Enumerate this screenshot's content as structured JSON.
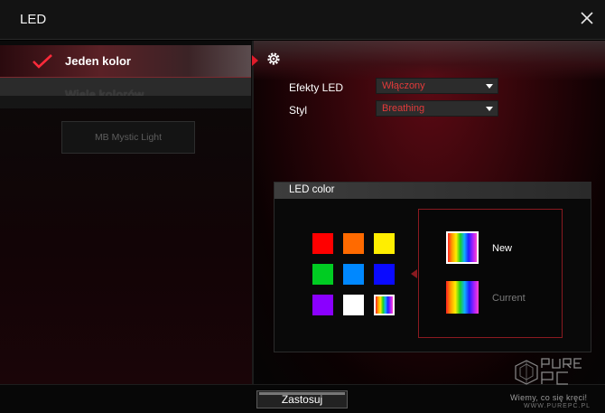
{
  "window": {
    "title": "LED"
  },
  "sidebar": {
    "items": [
      {
        "label": "Jeden kolor",
        "active": true
      },
      {
        "label": "Wiele kolorów",
        "active": false
      }
    ],
    "mb_button": "MB Mystic Light"
  },
  "settings": {
    "effects_label": "Efekty LED",
    "effects_value": "Włączony",
    "style_label": "Styl",
    "style_value": "Breathing"
  },
  "led_color": {
    "title": "LED color",
    "swatches": [
      {
        "name": "red",
        "color": "#ff0000"
      },
      {
        "name": "orange",
        "color": "#ff6a00"
      },
      {
        "name": "yellow",
        "color": "#ffee00"
      },
      {
        "name": "green",
        "color": "#00cc22"
      },
      {
        "name": "sky-blue",
        "color": "#0088ff"
      },
      {
        "name": "blue",
        "color": "#0a0aff"
      },
      {
        "name": "purple",
        "color": "#8a00ff"
      },
      {
        "name": "white",
        "color": "#ffffff"
      },
      {
        "name": "rainbow",
        "color": "rainbow",
        "selected": true
      }
    ],
    "new_label": "New",
    "current_label": "Current"
  },
  "footer": {
    "apply_label": "Zastosuj"
  },
  "watermark": {
    "text": "Wiemy, co się kręci!",
    "url": "WWW.PUREPC.PL",
    "logo": "PURE PC"
  },
  "colors": {
    "accent": "#e01b2a",
    "dropdown_text": "#e23a3a"
  }
}
